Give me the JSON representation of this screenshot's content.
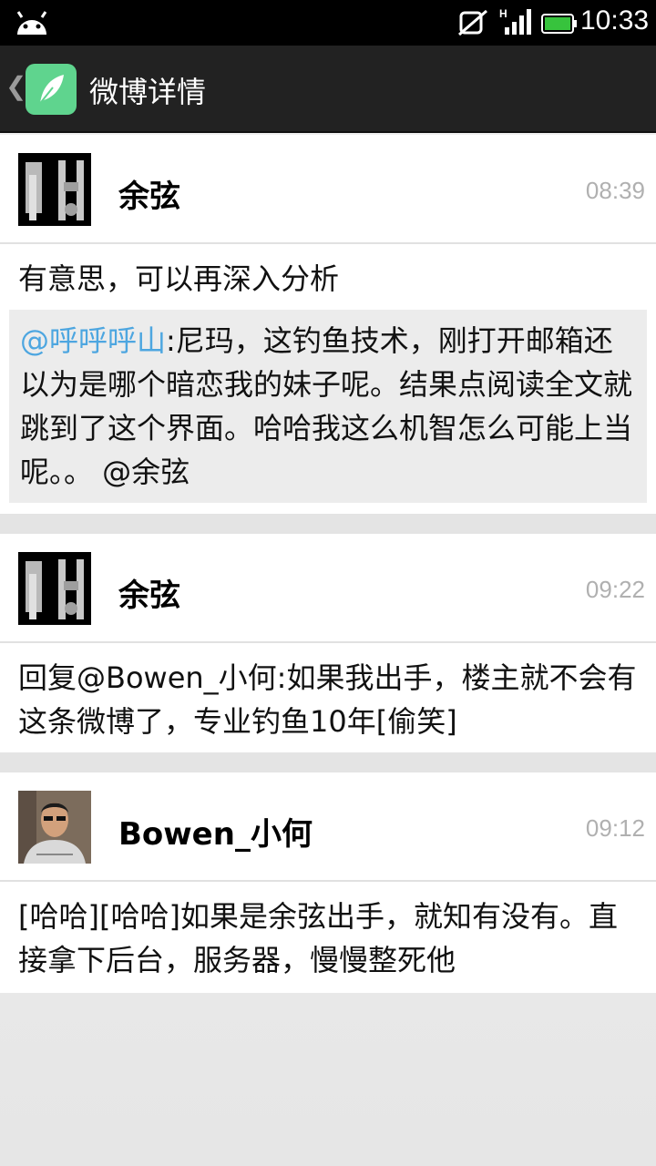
{
  "status_bar": {
    "time": "10:33",
    "icons": [
      "android-icon",
      "mute-icon",
      "signal-icon",
      "battery-icon"
    ],
    "signal_label": "H"
  },
  "action_bar": {
    "title": "微博详情",
    "back_icon": "chevron-left-icon",
    "app_icon": "feather-icon",
    "accent": "#5fd48e"
  },
  "posts": [
    {
      "name": "余弦",
      "time": "08:39",
      "text": "有意思，可以再深入分析",
      "quote": {
        "mention": "@呼呼呼山",
        "text": ":尼玛，这钓鱼技术，刚打开邮箱还以为是哪个暗恋我的妹子呢。结果点阅读全文就跳到了这个界面。哈哈我这么机智怎么可能上当呢。。 @余弦"
      }
    },
    {
      "name": "余弦",
      "time": "09:22",
      "text": "回复@Bowen_小何:如果我出手，楼主就不会有这条微博了，专业钓鱼10年[偷笑]"
    },
    {
      "name": "Bowen_小何",
      "time": "09:12",
      "text": "[哈哈][哈哈]如果是余弦出手，就知有没有。直接拿下后台，服务器，慢慢整死他"
    }
  ],
  "colors": {
    "mention": "#4da6e0",
    "timestamp": "#b0b0b0",
    "quote_bg": "#ececec"
  }
}
